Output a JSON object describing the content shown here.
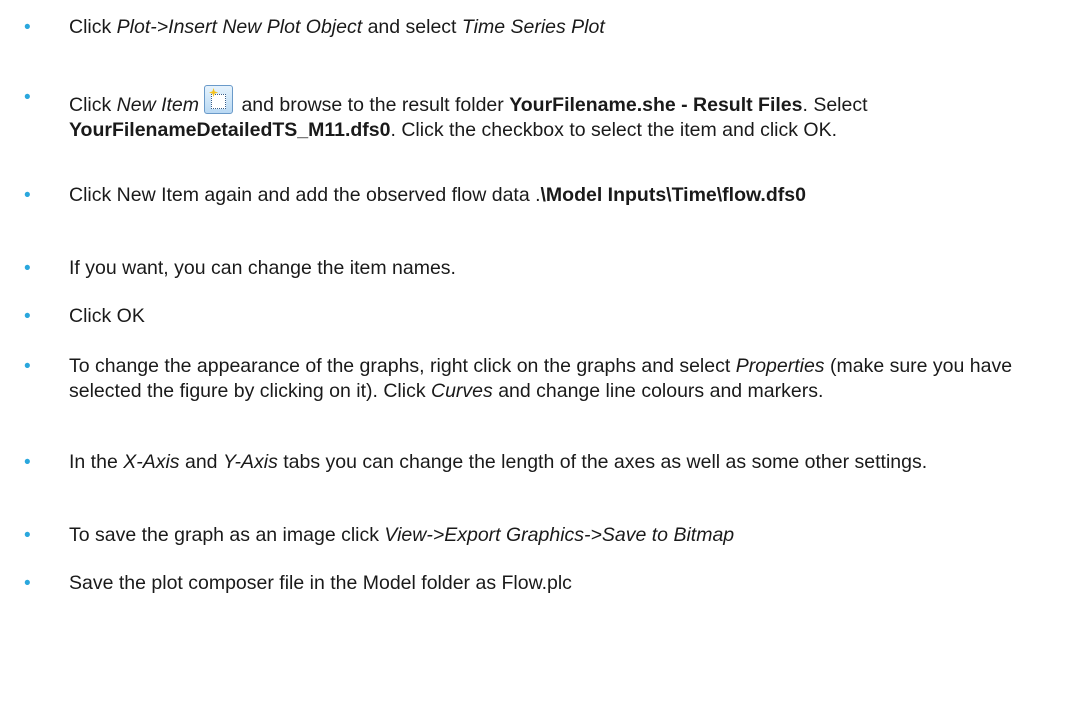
{
  "bullet_symbol": "•",
  "colors": {
    "bullet": "#2aa7dd",
    "text": "#1a1a1a",
    "icon_border": "#6a9ac9"
  },
  "icon": "new-item-icon",
  "bullets": [
    {
      "click": "Click ",
      "menu_path": "Plot->Insert New Plot Object",
      "and_select": " and select ",
      "plot_type": "Time Series Plot"
    },
    {
      "click": "Click ",
      "new_item": "New Item",
      "after_icon": " and browse to the result folder ",
      "result_folder": "YourFilename.she - Result Files",
      "select_text": ". Select ",
      "file_name": "YourFilenameDetailedTS_M11.dfs0",
      "rest": ". Click the checkbox to select the item and click OK."
    },
    {
      "text": "Click New Item again and add the observed flow data .",
      "path": "\\Model Inputs\\Time\\flow.dfs0"
    },
    {
      "text": "If you want, you can change the item names."
    },
    {
      "text": "Click OK"
    },
    {
      "part1": "To change the appearance of the graphs, right click on the graphs and select ",
      "properties": "Properties",
      "part2": " (make sure you have selected the figure by clicking on it). Click ",
      "curves": "Curves",
      "part3": " and change line colours and markers."
    },
    {
      "part1": "In the ",
      "x_axis": "X-Axis",
      "and": " and ",
      "y_axis": "Y-Axis",
      "part2": " tabs you can change the length of the axes as well as some other settings."
    },
    {
      "part1": "To save the graph as an image click ",
      "menu_path": "View->Export Graphics->Save to Bitmap"
    },
    {
      "text": "Save the plot composer file in the Model folder as Flow.plc"
    }
  ]
}
